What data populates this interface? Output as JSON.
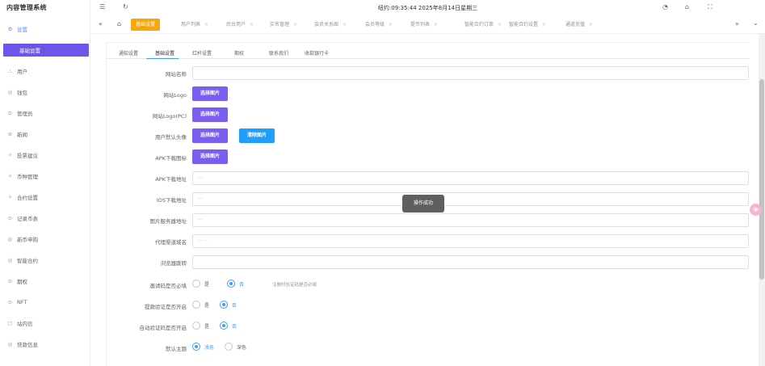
{
  "app": {
    "title": "内容管理系统"
  },
  "sidebar": {
    "items": [
      {
        "label": "设置",
        "icon": "gear-icon",
        "glyph": "⚙"
      },
      {
        "label": "基础设置",
        "icon": "",
        "glyph": ""
      },
      {
        "label": "用户",
        "icon": "user-icon",
        "glyph": "⛬"
      },
      {
        "label": "钱包",
        "icon": "wallet-icon",
        "glyph": "◎"
      },
      {
        "label": "管理员",
        "icon": "admin-icon",
        "glyph": "⊙"
      },
      {
        "label": "新闻",
        "icon": "news-icon",
        "glyph": "⊘"
      },
      {
        "label": "投票建议",
        "icon": "vote-icon",
        "glyph": "✧"
      },
      {
        "label": "币种管理",
        "icon": "coin-icon",
        "glyph": "✧"
      },
      {
        "label": "合约设置",
        "icon": "contract-icon",
        "glyph": "✧"
      },
      {
        "label": "记录币表",
        "icon": "record-icon",
        "glyph": "⊝"
      },
      {
        "label": "新币申购",
        "icon": "newcoin-icon",
        "glyph": "◎"
      },
      {
        "label": "智能合约",
        "icon": "smart-icon",
        "glyph": "◎"
      },
      {
        "label": "期权",
        "icon": "option-icon",
        "glyph": "⊝"
      },
      {
        "label": "NFT",
        "icon": "nft-icon",
        "glyph": "⊝"
      },
      {
        "label": "站内信",
        "icon": "mail-icon",
        "glyph": "◻"
      },
      {
        "label": "贷款信息",
        "icon": "loan-icon",
        "glyph": "◎"
      }
    ]
  },
  "header": {
    "clock": "纽约:09:35:44 2025年8月14日星期三",
    "menu_glyph": "☰",
    "refresh_glyph": "↻",
    "right_glyphs": [
      "◔",
      "⌂",
      "⛶"
    ]
  },
  "tags": {
    "home_glyph": "⌂",
    "back_glyph": "«",
    "more_glyph": "»",
    "down_glyph": "⌄",
    "items": [
      {
        "label": "基础设置",
        "active": true
      },
      {
        "label": "用户列表",
        "active": false
      },
      {
        "label": "后台用户",
        "active": false
      },
      {
        "label": "实名管理",
        "active": false
      },
      {
        "label": "会员关系图",
        "active": false
      },
      {
        "label": "会员等级",
        "active": false
      },
      {
        "label": "提币列表",
        "active": false
      },
      {
        "label": "智能合约订单",
        "active": false
      },
      {
        "label": "智能合约设置",
        "active": false
      },
      {
        "label": "通道充值",
        "active": false
      }
    ]
  },
  "tabs": [
    "通知设置",
    "基础设置",
    "红杆设置",
    "期权",
    "联系我们",
    "收款银行卡"
  ],
  "form": {
    "site_name_label": "网站名称",
    "logo_label": "网站Logo",
    "logo_pc_label": "网站Logo(PC)",
    "avatar_label": "用户默认头像",
    "apk_icon_label": "APK下载图标",
    "apk_url_label": "APK下载地址",
    "ios_url_label": "IOS下载地址",
    "img_server_label": "图片服务器地址",
    "proxy_label": "代理渠道域名",
    "browser_label": "浏览器跳转",
    "choose_image": "选择图片",
    "clear_image": "清除图片",
    "site_name_value": "",
    "apk_url_value": "—",
    "ios_url_value": "—",
    "img_server_value": "—",
    "proxy_value": "— —",
    "browser_value": "",
    "invite_label": "邀请码是否必填",
    "withdraw_label": "提款验证是否开启",
    "autoverify_label": "自动验证码是否开启",
    "theme_label": "默认主题",
    "yes": "是",
    "no": "否",
    "light": "浅色",
    "dark": "深色",
    "invite_note": "注册时验证码是否必填"
  },
  "toast": {
    "text": "操作成功"
  },
  "float_glyph": "❀"
}
